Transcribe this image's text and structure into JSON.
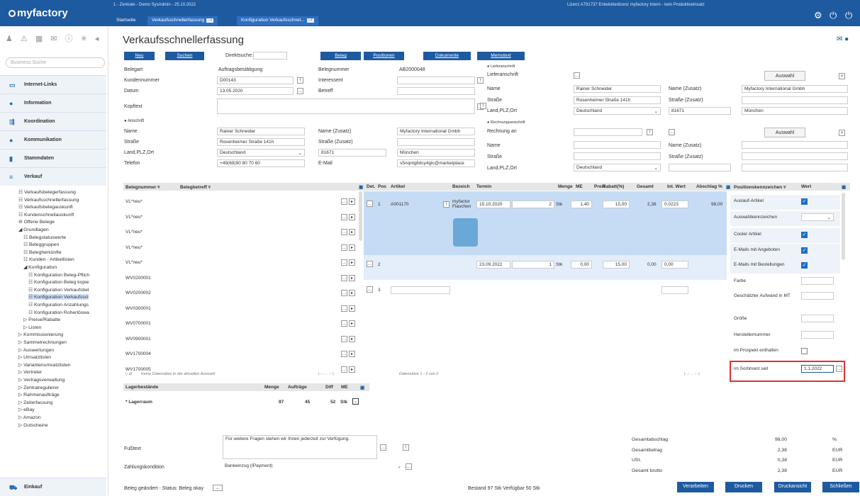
{
  "header": {
    "logo": "myfactory",
    "info": "1 - Zentrale - Demo SysAdmin - 25.10.2022",
    "license": "Lizenz A791737 Entwicklerlizenz myfactory Intern - kein Produktiveinsatz",
    "tabs": [
      {
        "label": "Startseite"
      },
      {
        "label": "Verkaufsschnellerfassung"
      },
      {
        "label": "Konfiguration Verkaufsschnel..."
      }
    ]
  },
  "sidebar": {
    "search_placeholder": "Business Suche",
    "sections": {
      "links": "Internet-Links",
      "info": "Information",
      "koord": "Koordination",
      "komm": "Kommunikation",
      "stamm": "Stammdaten",
      "verkauf": "Verkauf",
      "einkauf": "Einkauf"
    },
    "tree": [
      "Verkaufsbelegerfassung",
      "Verkaufsschnellerfassung",
      "Verkaufsbelegauskunft",
      "Kundenschnellauskunft",
      "Offene Belege",
      "Grundlagen",
      "Belegstatuswerte",
      "Beleggruppen",
      "Belegherkünfte",
      "Kunden - Artikellisten",
      "Konfiguration",
      "Konfiguration Beleg-Pflich",
      "Konfiguration Beleg kopie",
      "Konfiguration Verkaufsbel",
      "Konfiguration Verkaufsscl",
      "Konfiguration Anzahlungs",
      "Konfiguration Roherlöswa",
      "Preise/Rabatte",
      "Listen",
      "Kommissionierung",
      "Sammelrechnungen",
      "Auswertungen",
      "Umsatzlisten",
      "Variantenumsatzlisten",
      "Vertreter",
      "Vertragsverwaltung",
      "Zentralregulierer",
      "Rahmenaufträge",
      "Zeiterfassung",
      "eBay",
      "Amazon",
      "Gutscheine"
    ]
  },
  "page": {
    "title": "Verkaufsschnellerfassung"
  },
  "toolbar": {
    "neu": "Neu",
    "suchen": "Suchen",
    "direktsuche": "Direktsuche:",
    "beleg": "Beleg",
    "positionen": "Positionen",
    "dokumente": "Dokumente",
    "memotext": "Memotext"
  },
  "form": {
    "belegart_l": "Belegart",
    "belegart": "Auftragsbestätigung",
    "belegnummer_l": "Belegnummer",
    "belegnummer": "AB2000048",
    "kundennummer_l": "Kundennummer",
    "kundennummer": "D00143",
    "interessent_l": "Interessent",
    "datum_l": "Datum",
    "datum": "13.05.2020",
    "betreff_l": "Betreff",
    "kopftext_l": "Kopftext",
    "anschrift_l": "Anschrift",
    "name_l": "Name",
    "name": "Rainer Schneider",
    "namez_l": "Name (Zusatz)",
    "namez": "Myfactory International Gmbh",
    "strasse_l": "Straße",
    "strasse": "Rosenheimer Straße 141h",
    "strassez_l": "Straße (Zusatz)",
    "land_l": "Land,PLZ,Ort",
    "land": "Deutschland",
    "plz": "81671",
    "ort": "München",
    "telefon_l": "Telefon",
    "telefon": "+49(69)90 80 70 60",
    "email_l": "E-Mail",
    "email": "s5nqntg8dcy4glc@marketplace",
    "liefer_h": "Lieferanschrift",
    "liefer_l": "Lieferanschrift",
    "auswahl": "Auswahl",
    "rech_h": "Rechnungsanschrift",
    "rech_l": "Rechnung an"
  },
  "belegliste": {
    "col1": "Belegnummer",
    "col2": "Belegbetreff",
    "rows": [
      "VL*neu*",
      "VL*neu*",
      "VL*neu*",
      "VL*neu*",
      "VL*neu*",
      "WV0200001",
      "WV0200002",
      "WV0300001",
      "WV0700001",
      "WV0900001",
      "WV1700004",
      "WV1700005"
    ],
    "footer": "Keine Datensätze in der aktuellen Auswahl"
  },
  "positionen": {
    "cols": {
      "det": "Det.",
      "pos": "Pos",
      "artikel": "Artikel",
      "bezeich": "Bezeich",
      "termin": "Termin",
      "menge": "Menge",
      "me": "ME",
      "preis": "Preis",
      "rabatt": "Rabatt(%)",
      "gesamt": "Gesamt",
      "intwert": "Int. Wert",
      "abschlag": "Abschlag %"
    },
    "rows": [
      {
        "pos": "1",
        "artikel": "A001170",
        "bezeich": "myfactor Flaschen",
        "termin": "15.10.2020",
        "menge": "2",
        "me": "Stk",
        "preis": "1,40",
        "rabatt": "15,00",
        "gesamt": "2,38",
        "intwert": "0,0223",
        "abschlag": "98,00"
      },
      {
        "pos": "2",
        "termin": "23.09.2022",
        "menge": "1",
        "me": "Stk",
        "preis": "0,00",
        "rabatt": "15,00",
        "gesamt": "0,00",
        "intwert": "0,00"
      },
      {
        "pos": "3"
      }
    ],
    "footer": "Datensätze 1 - 2 von 2"
  },
  "kennz": {
    "col1": "Positionskennzeichen",
    "col2": "Wert",
    "rows": [
      {
        "label": "Auslauf-Artikel",
        "type": "check"
      },
      {
        "label": "Auswahlkennzeichen",
        "type": "select"
      },
      {
        "label": "Cooler Artikel",
        "type": "check"
      },
      {
        "label": "E-Mails mit Angeboten",
        "type": "check"
      },
      {
        "label": "E-Mails mit Bestellungen",
        "type": "check"
      },
      {
        "label": "Farbe",
        "type": "input"
      },
      {
        "label": "Geschätzter Aufwand in MT",
        "type": "input"
      },
      {
        "label": "Größe",
        "type": "input"
      },
      {
        "label": "Herstellernummer",
        "type": "input"
      },
      {
        "label": "im Prospekt enthalten",
        "type": "empty"
      },
      {
        "label": "im Sortiment seit",
        "type": "date",
        "value": "1.1.2022"
      }
    ]
  },
  "lager": {
    "col1": "Lagerbestände",
    "col2": "Menge",
    "col3": "Aufträge",
    "col4": "Diff",
    "col5": "ME",
    "row": {
      "name": "* Lagerraum",
      "menge": "97",
      "auftraege": "45",
      "diff": "52",
      "me": "Stk"
    }
  },
  "footer": {
    "fusstext_l": "Fußtext",
    "fusstext": "Für weitere Fragen stehen wir Ihnen jederzeit zur Verfügung.",
    "zk_l": "Zahlungskondition",
    "zk": "Bankeinzug (IPayment)",
    "status": "Beleg geändert - Status: Beleg okay",
    "bestand": "Bestand 97 Stk Verfügbar 50 Stk",
    "totals": [
      {
        "label": "Gesamtabschlag",
        "value": "98,00",
        "unit": "%"
      },
      {
        "label": "Gesamtbetrag",
        "value": "2,38",
        "unit": "EUR"
      },
      {
        "label": "USt.",
        "value": "0,38",
        "unit": "EUR"
      },
      {
        "label": "Gesamt brutto",
        "value": "2,38",
        "unit": "EUR"
      }
    ],
    "verarbeiten": "Verarbeiten",
    "drucken": "Drucken",
    "druckansicht": "Druckansicht",
    "schliessen": "Schließen"
  }
}
